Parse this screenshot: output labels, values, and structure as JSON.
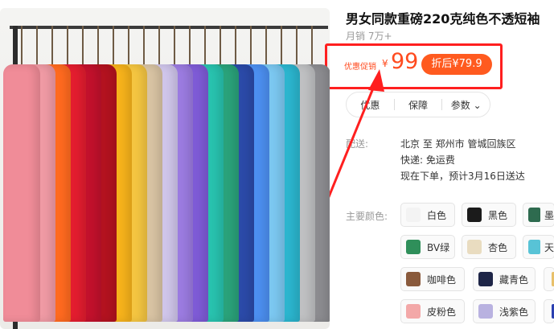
{
  "product": {
    "title": "男女同款重磅220克纯色不透短袖",
    "sales": "月销 7万+",
    "price_label": "优惠促销",
    "currency": "¥",
    "price": "99",
    "after_price": "折后¥79.9"
  },
  "tabs": [
    "优惠",
    "保障",
    "参数"
  ],
  "shipping": {
    "label": "配送:",
    "route": "北京  至  郑州市 管城回族区",
    "fee": "快递: 免运费",
    "eta": "现在下单，预计3月16日送达"
  },
  "colors_label": "主要颜色:",
  "colors": [
    {
      "name": "白色",
      "hex": "#f3f3f3"
    },
    {
      "name": "黑色",
      "hex": "#1b1b1b"
    },
    {
      "name": "墨",
      "hex": "#2e6b4f"
    },
    {
      "name": "BV绿",
      "hex": "#2f8f5a"
    },
    {
      "name": "杏色",
      "hex": "#e9dcc0"
    },
    {
      "name": "天",
      "hex": "#58c3d6"
    },
    {
      "name": "咖啡色",
      "hex": "#8a5a3c"
    },
    {
      "name": "藏青色",
      "hex": "#1e2547"
    },
    {
      "name": "",
      "hex": "#e8c06a"
    },
    {
      "name": "皮粉色",
      "hex": "#f3a8a8"
    },
    {
      "name": "浅紫色",
      "hex": "#b9b2e0"
    },
    {
      "name": "",
      "hex": "#2a3fb0"
    }
  ],
  "accent": "#ff4b1f",
  "highlight": "#ff1f1f"
}
